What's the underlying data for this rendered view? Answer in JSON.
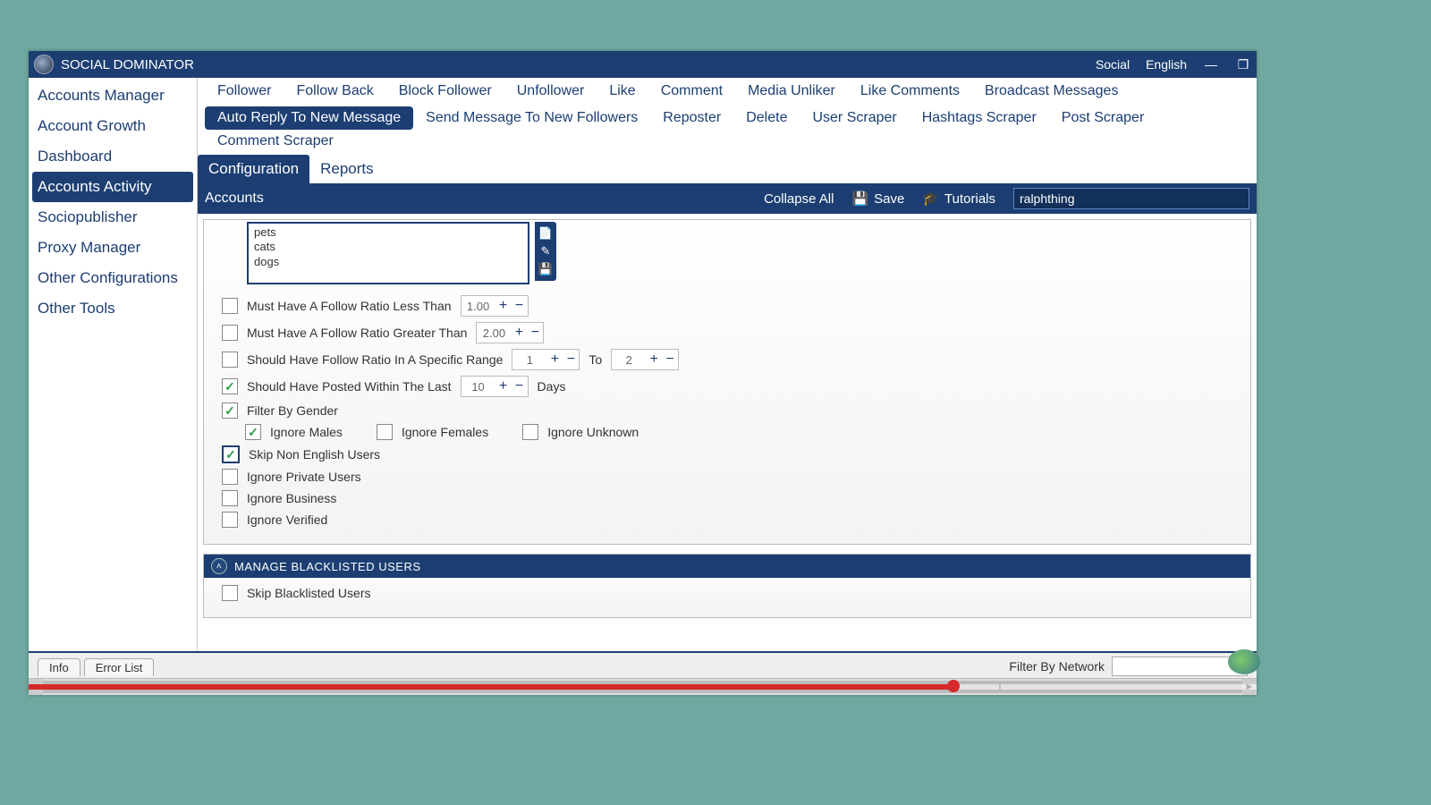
{
  "title": "SOCIAL DOMINATOR",
  "title_right": {
    "social": "Social",
    "language": "English"
  },
  "sidebar": {
    "items": [
      "Accounts Manager",
      "Account Growth",
      "Dashboard",
      "Accounts Activity",
      "Sociopublisher",
      "Proxy Manager",
      "Other Configurations",
      "Other Tools"
    ],
    "active_index": 3
  },
  "tabs_row1": [
    "Follower",
    "Follow Back",
    "Block Follower",
    "Unfollower",
    "Like",
    "Comment",
    "Media Unliker",
    "Like Comments",
    "Broadcast Messages"
  ],
  "tabs_row2": [
    "Auto Reply To New Message",
    "Send Message To New Followers",
    "Reposter",
    "Delete",
    "User Scraper",
    "Hashtags Scraper",
    "Post Scraper",
    "Comment Scraper"
  ],
  "tabs_active_row": 2,
  "tabs_active_index": 0,
  "subtabs": [
    "Configuration",
    "Reports"
  ],
  "subtabs_active": 0,
  "accounts_bar": {
    "title": "Accounts",
    "collapse": "Collapse All",
    "save": "Save",
    "tutorials": "Tutorials",
    "search_value": "ralphthing"
  },
  "keywords_text": "pets\ncats\ndogs",
  "options": {
    "ratio_less": {
      "checked": false,
      "label": "Must Have A Follow Ratio Less Than",
      "value": "1.00"
    },
    "ratio_greater": {
      "checked": false,
      "label": "Must Have A Follow Ratio Greater Than",
      "value": "2.00"
    },
    "ratio_range": {
      "checked": false,
      "label": "Should Have Follow Ratio In A Specific Range",
      "from": "1",
      "to_label": "To",
      "to": "2"
    },
    "posted_last": {
      "checked": true,
      "label": "Should Have Posted Within The Last",
      "value": "10",
      "unit": "Days"
    },
    "filter_gender": {
      "checked": true,
      "label": "Filter By Gender"
    },
    "ignore_males": {
      "checked": true,
      "label": "Ignore Males"
    },
    "ignore_females": {
      "checked": false,
      "label": "Ignore Females"
    },
    "ignore_unknown": {
      "checked": false,
      "label": "Ignore Unknown"
    },
    "skip_non_english": {
      "checked": true,
      "label": "Skip Non English Users"
    },
    "ignore_private": {
      "checked": false,
      "label": "Ignore Private Users"
    },
    "ignore_business": {
      "checked": false,
      "label": "Ignore Business"
    },
    "ignore_verified": {
      "checked": false,
      "label": "Ignore Verified"
    }
  },
  "blacklist_panel": {
    "title": "MANAGE BLACKLISTED USERS",
    "skip": {
      "checked": false,
      "label": "Skip Blacklisted Users"
    }
  },
  "footer": {
    "info": "Info",
    "error_list": "Error List",
    "filter_label": "Filter By Network"
  }
}
